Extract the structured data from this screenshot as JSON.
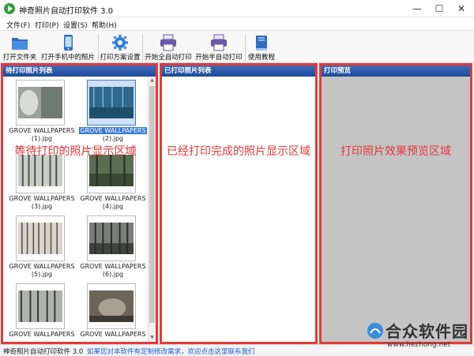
{
  "window": {
    "title": "神奇照片自动打印软件 3.0",
    "controls": {
      "minimize": "—",
      "maximize": "☐",
      "close": "✕"
    }
  },
  "menu": [
    {
      "label": "文件(F)"
    },
    {
      "label": "打印(P)"
    },
    {
      "label": "设置(S)"
    },
    {
      "label": "帮助(H)"
    }
  ],
  "toolbar": [
    {
      "label": "打开文件夹",
      "icon": "folder-icon"
    },
    {
      "label": "打开手机中的照片",
      "icon": "phone-icon"
    },
    {
      "label": "打印方案设置",
      "icon": "gear-icon"
    },
    {
      "label": "开始全自动打印",
      "icon": "printer-icon"
    },
    {
      "label": "开始半自动打印",
      "icon": "printer-icon"
    },
    {
      "label": "使用教程",
      "icon": "book-icon"
    }
  ],
  "panels": {
    "pending": {
      "title": "待打印照片列表",
      "note": "等待打印的照片显示区域",
      "photos": [
        {
          "line1": "GROVE WALLPAPERS",
          "line2": "(1).jpg",
          "selected": false
        },
        {
          "line1": "GROVE WALLPAPERS",
          "line2": "(2).jpg",
          "selected": true
        },
        {
          "line1": "GROVE WALLPAPERS",
          "line2": "(3).jpg",
          "selected": false
        },
        {
          "line1": "GROVE WALLPAPERS",
          "line2": "(4).jpg",
          "selected": false
        },
        {
          "line1": "GROVE WALLPAPERS",
          "line2": "(5).jpg",
          "selected": false
        },
        {
          "line1": "GROVE WALLPAPERS",
          "line2": "(6).jpg",
          "selected": false
        },
        {
          "line1": "GROVE WALLPAPERS",
          "line2": "",
          "selected": false
        },
        {
          "line1": "GROVE WALLPAPERS",
          "line2": "",
          "selected": false
        }
      ]
    },
    "printed": {
      "title": "已打印照片列表",
      "note": "已经打印完成的照片显示区域"
    },
    "preview": {
      "title": "打印预览",
      "note": "打印照片效果预览区域"
    }
  },
  "status": {
    "version": "神奇照片自动打印软件 3.0",
    "link": "如果您对本软件有定制修改需求，欢迎点击这里联系我们"
  },
  "watermark": {
    "name": "合众软件园",
    "url": "www.hezhong.net"
  },
  "colors": {
    "highlight_red": "#e53a3a",
    "panel_header": "#2a55a8",
    "link_blue": "#1a5fd6",
    "selection": "#3b7ad6"
  }
}
